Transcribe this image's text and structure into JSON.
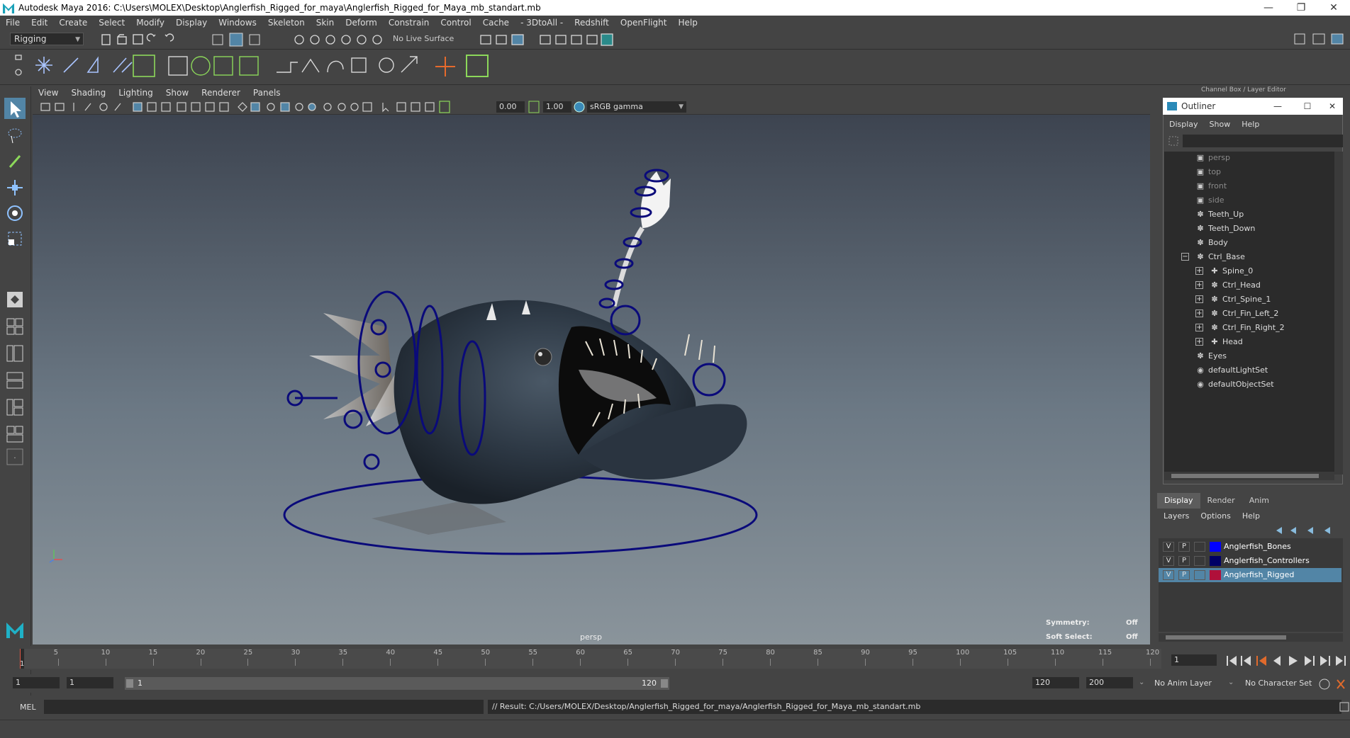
{
  "window": {
    "title": "Autodesk Maya 2016: C:\\Users\\MOLEX\\Desktop\\Anglerfish_Rigged_for_maya\\Anglerfish_Rigged_for_Maya_mb_standart.mb"
  },
  "menubar": [
    "File",
    "Edit",
    "Create",
    "Select",
    "Modify",
    "Display",
    "Windows",
    "Skeleton",
    "Skin",
    "Deform",
    "Constrain",
    "Control",
    "Cache",
    "- 3DtoAll -",
    "Redshift",
    "OpenFlight",
    "Help"
  ],
  "statusline": {
    "mode": "Rigging",
    "live_surface": "No Live Surface"
  },
  "viewport": {
    "menus": [
      "View",
      "Shading",
      "Lighting",
      "Show",
      "Renderer",
      "Panels"
    ],
    "near_value": "0.00",
    "far_value": "1.00",
    "color_space": "sRGB gamma",
    "camera": "persp",
    "symmetry_label": "Symmetry:",
    "symmetry_value": "Off",
    "soft_select_label": "Soft Select:",
    "soft_select_value": "Off"
  },
  "right_panel": {
    "tab_label": "Channel Box / Layer Editor"
  },
  "outliner": {
    "title": "Outliner",
    "menus": [
      "Display",
      "Show",
      "Help"
    ],
    "items": [
      {
        "label": "persp",
        "type": "camera",
        "dim": true
      },
      {
        "label": "top",
        "type": "camera",
        "dim": true
      },
      {
        "label": "front",
        "type": "camera",
        "dim": true
      },
      {
        "label": "side",
        "type": "camera",
        "dim": true
      },
      {
        "label": "Teeth_Up",
        "type": "mesh"
      },
      {
        "label": "Teeth_Down",
        "type": "mesh"
      },
      {
        "label": "Body",
        "type": "mesh"
      },
      {
        "label": "Ctrl_Base",
        "type": "mesh",
        "expanded": true
      },
      {
        "label": "Spine_0",
        "type": "joint",
        "child": true
      },
      {
        "label": "Ctrl_Head",
        "type": "mesh",
        "child": true
      },
      {
        "label": "Ctrl_Spine_1",
        "type": "mesh",
        "child": true
      },
      {
        "label": "Ctrl_Fin_Left_2",
        "type": "mesh",
        "child": true
      },
      {
        "label": "Ctrl_Fin_Right_2",
        "type": "mesh",
        "child": true
      },
      {
        "label": "Head",
        "type": "joint",
        "child": true
      },
      {
        "label": "Eyes",
        "type": "mesh"
      },
      {
        "label": "defaultLightSet",
        "type": "set"
      },
      {
        "label": "defaultObjectSet",
        "type": "set"
      }
    ]
  },
  "layer_editor": {
    "tabs": [
      "Display",
      "Render",
      "Anim"
    ],
    "menus": [
      "Layers",
      "Options",
      "Help"
    ],
    "layers": [
      {
        "v": "V",
        "p": "P",
        "color": "#0000ff",
        "name": "Anglerfish_Bones",
        "selected": false
      },
      {
        "v": "V",
        "p": "P",
        "color": "#000066",
        "name": "Anglerfish_Controllers",
        "selected": false
      },
      {
        "v": "V",
        "p": "P",
        "color": "#b0103a",
        "name": "Anglerfish_Rigged",
        "selected": true
      }
    ]
  },
  "timeline": {
    "ticks": [
      "5",
      "10",
      "15",
      "20",
      "25",
      "30",
      "35",
      "40",
      "45",
      "50",
      "55",
      "60",
      "65",
      "70",
      "75",
      "80",
      "85",
      "90",
      "95",
      "100",
      "105",
      "110",
      "115",
      "120"
    ],
    "start_marker": "1",
    "current_frame": "1"
  },
  "range": {
    "start": "1",
    "playback_start": "1",
    "range_start_label": "1",
    "range_end_label": "120",
    "playback_end": "120",
    "end": "200",
    "anim_layer": "No Anim Layer",
    "character_set": "No Character Set"
  },
  "command": {
    "language": "MEL",
    "result": "// Result: C:/Users/MOLEX/Desktop/Anglerfish_Rigged_for_maya/Anglerfish_Rigged_for_Maya_mb_standart.mb"
  },
  "colors": {
    "accent": "#5285a6",
    "viewport_top": "#3d4450",
    "viewport_bottom": "#8a949b",
    "controller_blue": "#0a0a7a"
  }
}
